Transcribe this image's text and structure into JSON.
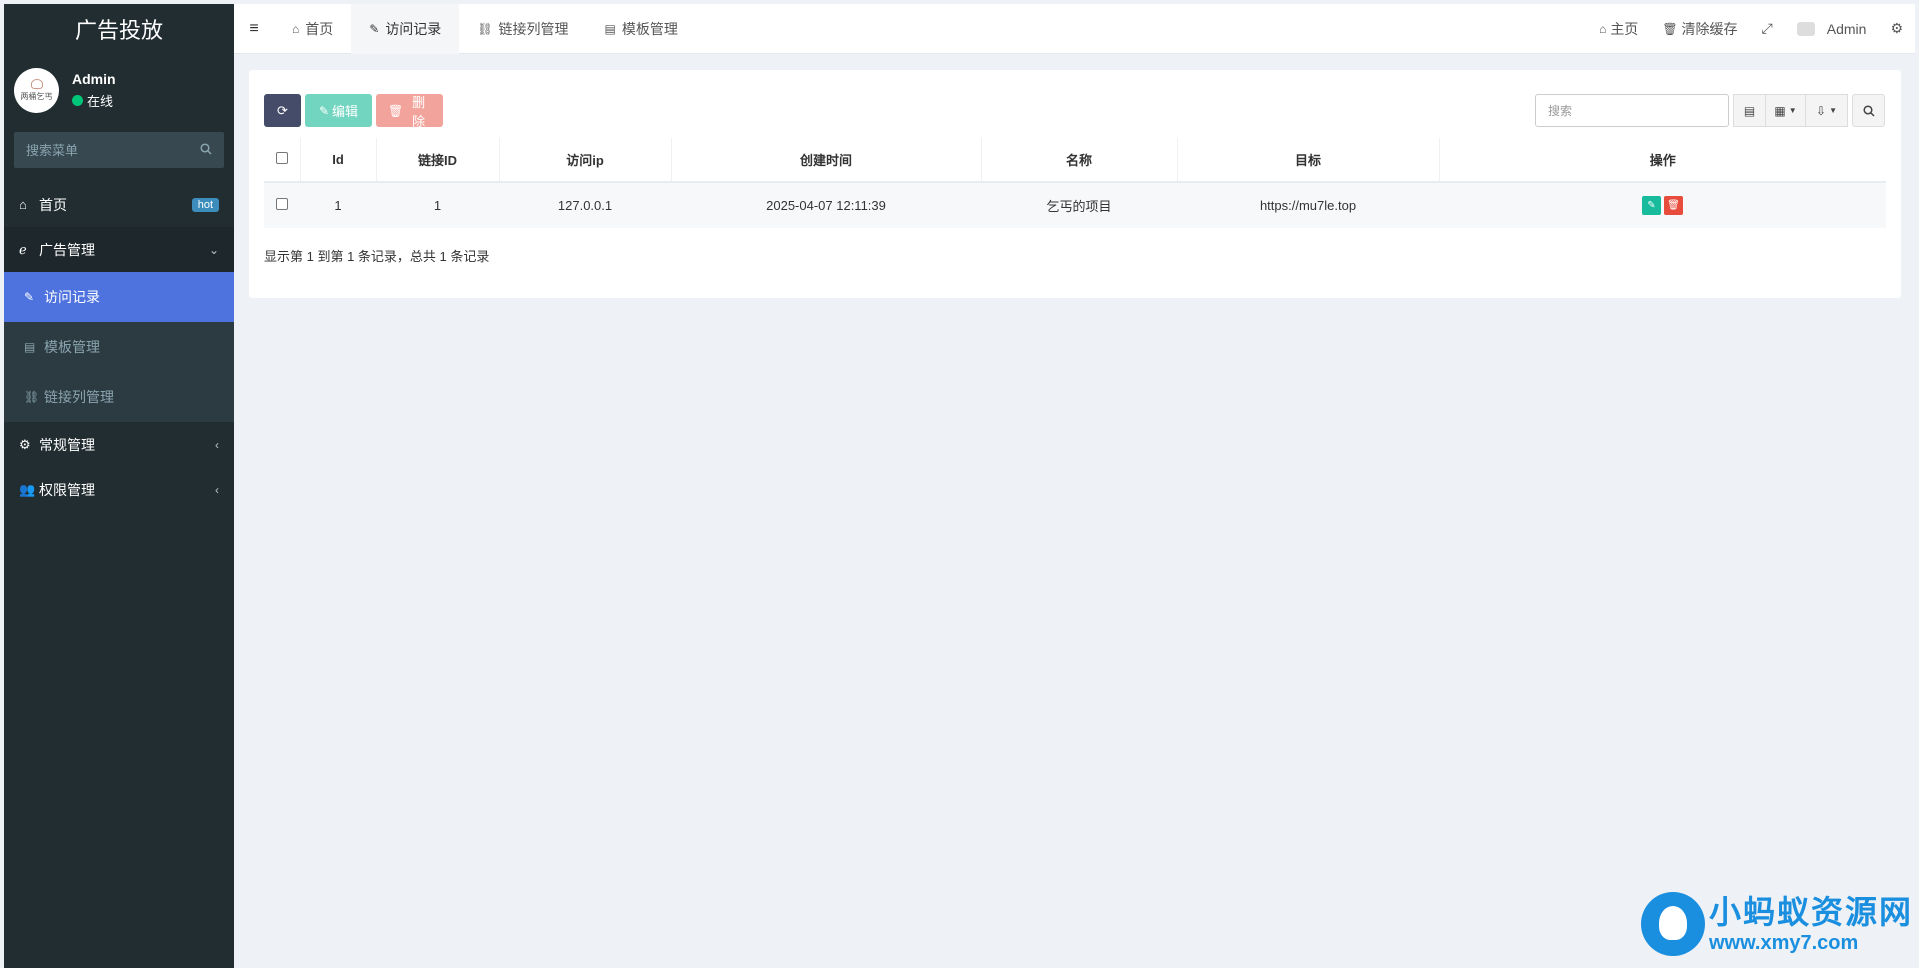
{
  "sidebar": {
    "brand": "广告投放",
    "avatar_text": "两桶乞丐",
    "user_name": "Admin",
    "user_status": "在线",
    "search_placeholder": "搜索菜单",
    "items": [
      {
        "label": "首页",
        "icon": "home-icon",
        "badge": "hot"
      },
      {
        "label": "广告管理",
        "icon": "ie-icon",
        "expanded": true,
        "children": [
          {
            "label": "访问记录",
            "icon": "pencil-icon",
            "active": true
          },
          {
            "label": "模板管理",
            "icon": "table-icon"
          },
          {
            "label": "链接列管理",
            "icon": "unlink-icon"
          }
        ]
      },
      {
        "label": "常规管理",
        "icon": "cogs-icon"
      },
      {
        "label": "权限管理",
        "icon": "group-icon"
      }
    ]
  },
  "topbar": {
    "tabs": [
      {
        "label": "首页",
        "icon": "home-icon"
      },
      {
        "label": "访问记录",
        "icon": "pencil-icon",
        "active": true
      },
      {
        "label": "链接列管理",
        "icon": "unlink-icon"
      },
      {
        "label": "模板管理",
        "icon": "table-icon"
      }
    ],
    "right": {
      "home": "主页",
      "clear_cache": "清除缓存",
      "user": "Admin"
    }
  },
  "toolbar": {
    "edit_label": "编辑",
    "delete_label": "删除",
    "search_placeholder": "搜索"
  },
  "table": {
    "columns": [
      "Id",
      "链接ID",
      "访问ip",
      "创建时间",
      "名称",
      "目标",
      "操作"
    ],
    "rows": [
      {
        "id": "1",
        "link_id": "1",
        "ip": "127.0.0.1",
        "created": "2025-04-07 12:11:39",
        "name": "乞丐的项目",
        "target": "https://mu7le.top"
      }
    ]
  },
  "pager_info": "显示第 1 到第 1 条记录，总共 1 条记录",
  "watermark": {
    "title": "小蚂蚁资源网",
    "url": "www.xmy7.com"
  },
  "colors": {
    "sidebar_bg": "#222d32",
    "active_menu": "#4e73df",
    "edit_green": "#18bc9c",
    "delete_red": "#e74c3c",
    "hot_badge": "#3c8dbc"
  }
}
